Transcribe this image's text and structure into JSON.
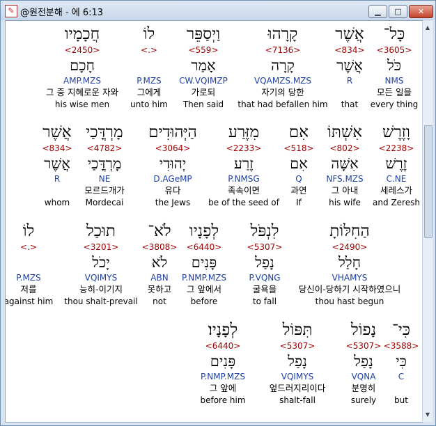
{
  "window": {
    "title": "@원전분해 - 에 6:13",
    "app_icon": "bible-app-icon",
    "buttons": {
      "minimize": "▁",
      "maximize": "□",
      "close": "✕"
    }
  },
  "rows": [
    [
      {
        "heb1": "כָּל־",
        "strong": "<3605>",
        "heb2": "כֹּל",
        "gram": "NMS",
        "kor": "모든 일을",
        "eng": "every thing"
      },
      {
        "heb1": "אֲשֶׁר",
        "strong": "<834>",
        "heb2": "אֲשֶׁר",
        "gram": "R",
        "kor": "",
        "eng": "that"
      },
      {
        "heb1": "קָרָהוּ",
        "strong": "<7136>",
        "heb2": "קָרָה",
        "gram": "VQAMZS.MZS",
        "kor": "자기의 당한",
        "eng": "that had befallen him"
      },
      {
        "heb1": "וַיְסַפֵּר",
        "strong": "<559>",
        "heb2": "אָמַר",
        "gram": "CW.VQIMZP",
        "kor": "가로되",
        "eng": "Then said"
      },
      {
        "heb1": "לוֹ",
        "strong": "<.>",
        "heb2": "",
        "gram": "P.MZS",
        "kor": "그에게",
        "eng": "unto him"
      },
      {
        "heb1": "חֲכָמָיו",
        "strong": "<2450>",
        "heb2": "חָכָם",
        "gram": "AMP.MZS",
        "kor": "그 중 지혜로운 자와",
        "eng": "his wise men"
      }
    ],
    [
      {
        "heb1": "וָזֶרֶשׁ",
        "strong": "<2238>",
        "heb2": "זֶרֶשׁ",
        "gram": "C.NE",
        "kor": "세레스가",
        "eng": "and Zeresh"
      },
      {
        "heb1": "אִשְׁתּוֹ",
        "strong": "<802>",
        "heb2": "אִשָּׁה",
        "gram": "NFS.MZS",
        "kor": "그 아내",
        "eng": "his wife"
      },
      {
        "heb1": "אִם",
        "strong": "<518>",
        "heb2": "אִם",
        "gram": "Q",
        "kor": "과연",
        "eng": "If"
      },
      {
        "heb1": "מִזֶּרַע",
        "strong": "<2233>",
        "heb2": "זֶרַע",
        "gram": "P.NMSG",
        "kor": "족속이면",
        "eng": "be of the seed of"
      },
      {
        "heb1": "הַיְּהוּדִים",
        "strong": "<3064>",
        "heb2": "יְהוּדִי",
        "gram": "D.AGeMP",
        "kor": "유다",
        "eng": "the Jews"
      },
      {
        "heb1": "מָרְדֳּכַי",
        "strong": "<4782>",
        "heb2": "מָרְדֳּכַי",
        "gram": "NE",
        "kor": "모르드개가",
        "eng": "Mordecai"
      },
      {
        "heb1": "אֲשֶׁר",
        "strong": "<834>",
        "heb2": "אֲשֶׁר",
        "gram": "R",
        "kor": "",
        "eng": "whom"
      }
    ],
    [
      {
        "heb1": "הַחִלּוֹתָ",
        "strong": "<2490>",
        "heb2": "חָלַל",
        "gram": "VHAMYS",
        "kor": "당신이-당하기 시작하였으니",
        "eng": "thou hast begun"
      },
      {
        "heb1": "לִנְפֹּל",
        "strong": "<5307>",
        "heb2": "נָפַל",
        "gram": "P.VQNG",
        "kor": "굴욕을",
        "eng": "to fall"
      },
      {
        "heb1": "לְפָנָיו",
        "strong": "<6440>",
        "heb2": "פָּנִים",
        "gram": "P.NMP.MZS",
        "kor": "그 앞에서",
        "eng": "before"
      },
      {
        "heb1": "לֹא־",
        "strong": "<3808>",
        "heb2": "לֹא",
        "gram": "ABN",
        "kor": "못하고",
        "eng": "not"
      },
      {
        "heb1": "תוּכַל",
        "strong": "<3201>",
        "heb2": "יָכֹל",
        "gram": "VQIMYS",
        "kor": "능히-이기지",
        "eng": "thou shalt-prevail"
      },
      {
        "heb1": "לוֹ",
        "strong": "<.>",
        "heb2": "",
        "gram": "P.MZS",
        "kor": "저를",
        "eng": "against him"
      }
    ],
    [
      {
        "heb1": "כִּי־",
        "strong": "<3588>",
        "heb2": "כִּי",
        "gram": "C",
        "kor": "",
        "eng": "but"
      },
      {
        "heb1": "נָפוֹל",
        "strong": "<5307>",
        "heb2": "נָפַל",
        "gram": "VQNA",
        "kor": "분명히",
        "eng": "surely"
      },
      {
        "heb1": "תִּפּוֹל",
        "strong": "<5307>",
        "heb2": "נָפַל",
        "gram": "VQIMYS",
        "kor": "엎드러지리이다",
        "eng": "shalt-fall"
      },
      {
        "heb1": "לְפָנָיו׃",
        "strong": "<6440>",
        "heb2": "פָּנִים",
        "gram": "P.NMP.MZS",
        "kor": "그 앞에",
        "eng": "before him"
      }
    ]
  ]
}
